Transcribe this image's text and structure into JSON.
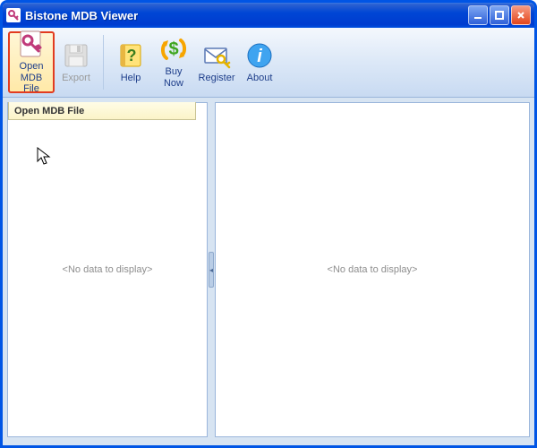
{
  "window": {
    "title": "Bistone MDB Viewer"
  },
  "toolbar": {
    "open_label": "Open MDB File",
    "export_label": "Export",
    "help_label": "Help",
    "buy_label": "Buy Now",
    "register_label": "Register",
    "about_label": "About"
  },
  "tabs": {
    "active_label": "Open MDB File"
  },
  "panes": {
    "left_empty": "<No data to display>",
    "right_empty": "<No data to display>"
  },
  "icons": {
    "app": "key-icon",
    "open": "key-file-icon",
    "export": "floppy-icon",
    "help": "help-icon",
    "buy": "dollar-arrows-icon",
    "register": "envelope-key-icon",
    "about": "info-icon"
  },
  "colors": {
    "accent": "#0055E5",
    "highlight_border": "#E23B1F"
  }
}
